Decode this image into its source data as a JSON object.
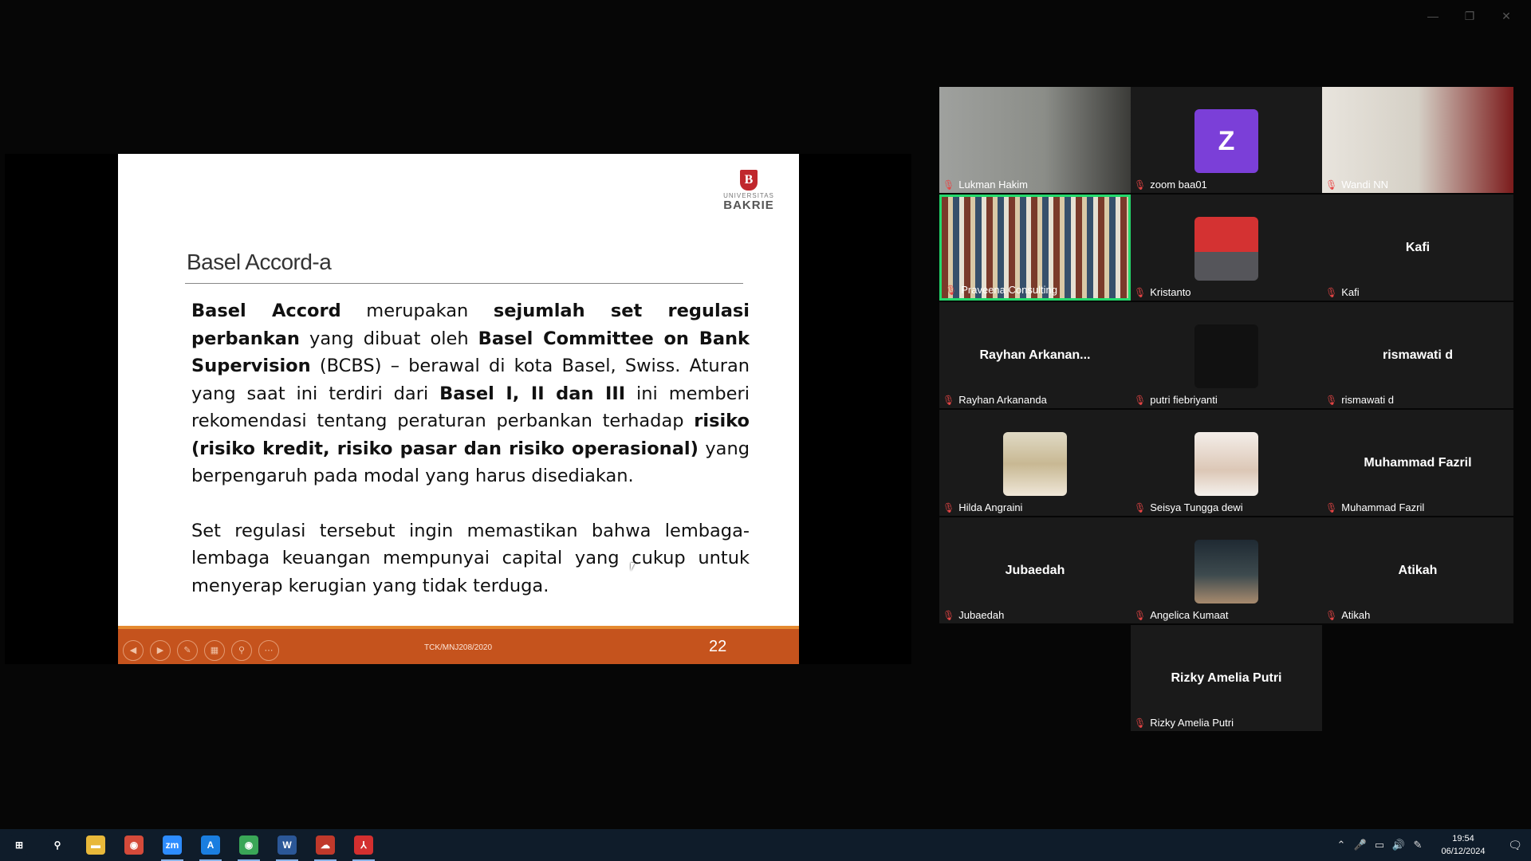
{
  "window": {
    "minimize": "—",
    "restore": "❐",
    "close": "✕"
  },
  "slide": {
    "logo_sub": "UNIVERSITAS",
    "logo_main": "BAKRIE",
    "title": "Basel Accord-a",
    "p1_segments": [
      {
        "t": "Basel Accord",
        "b": true
      },
      {
        "t": " merupakan ",
        "b": false
      },
      {
        "t": "sejumlah set regulasi perbankan",
        "b": true
      },
      {
        "t": " yang dibuat oleh ",
        "b": false
      },
      {
        "t": "Basel Committee on Bank Supervision",
        "b": true
      },
      {
        "t": " (BCBS) – berawal  di kota Basel, Swiss. Aturan yang saat ini terdiri dari ",
        "b": false
      },
      {
        "t": "Basel I, II dan III",
        "b": true
      },
      {
        "t": " ini memberi rekomendasi tentang peraturan perbankan terhadap ",
        "b": false
      },
      {
        "t": "risiko (risiko kredit, risiko pasar dan risiko operasional)",
        "b": true
      },
      {
        "t": " yang berpengaruh pada modal yang harus disediakan.",
        "b": false
      }
    ],
    "p2": "Set regulasi tersebut ingin memastikan bahwa lembaga-lembaga keuangan mempunyai capital yang cukup untuk menyerap kerugian yang tidak terduga.",
    "footer_code": "TCK/MNJ208/2020",
    "page_number": "22",
    "controls": [
      "◀",
      "▶",
      "✎",
      "▦",
      "⚲",
      "⋯"
    ]
  },
  "participants": [
    {
      "name": "Lukman Hakim",
      "kind": "video-man"
    },
    {
      "name": "zoom baa01",
      "kind": "letter",
      "letter": "Z"
    },
    {
      "name": "Wandi NN",
      "kind": "video-office"
    },
    {
      "name": "Praveena Consulting",
      "kind": "video-books",
      "active": true
    },
    {
      "name": "Kristanto",
      "kind": "avatar-red"
    },
    {
      "name": "Kafi",
      "kind": "text",
      "display": "Kafi"
    },
    {
      "name": "Rayhan Arkananda",
      "kind": "text",
      "display": "Rayhan  Arkanan..."
    },
    {
      "name": "putri fiebriyanti",
      "kind": "avatar-dark"
    },
    {
      "name": "rismawati d",
      "kind": "text",
      "display": "rismawati d"
    },
    {
      "name": "Hilda Angraini",
      "kind": "avatar-hijab"
    },
    {
      "name": "Seisya Tungga dewi",
      "kind": "avatar-woman"
    },
    {
      "name": "Muhammad Fazril",
      "kind": "text",
      "display": "Muhammad Fazril"
    },
    {
      "name": "Jubaedah",
      "kind": "text",
      "display": "Jubaedah"
    },
    {
      "name": "Angelica Kumaat",
      "kind": "avatar-night"
    },
    {
      "name": "Atikah",
      "kind": "text",
      "display": "Atikah"
    },
    {
      "name": "Rizky Amelia Putri",
      "kind": "text",
      "display": "Rizky Amelia Putri"
    }
  ],
  "taskbar": {
    "apps": [
      {
        "name": "windows-start-icon",
        "glyph": "⊞",
        "color": "#0f1c2a",
        "running": false
      },
      {
        "name": "search-icon",
        "glyph": "⚲",
        "color": "#0f1c2a",
        "running": false
      },
      {
        "name": "file-explorer-icon",
        "glyph": "▬",
        "color": "#e8b83a",
        "running": false
      },
      {
        "name": "chrome-icon",
        "glyph": "◉",
        "color": "#d44a3a",
        "running": false
      },
      {
        "name": "zoom-icon",
        "glyph": "zm",
        "color": "#2d8cff",
        "running": true
      },
      {
        "name": "app-a-icon",
        "glyph": "A",
        "color": "#1a7ee0",
        "running": true
      },
      {
        "name": "chrome-profile-icon",
        "glyph": "◉",
        "color": "#3aa657",
        "running": true
      },
      {
        "name": "word-icon",
        "glyph": "W",
        "color": "#2b5797",
        "running": true
      },
      {
        "name": "app-cloud-icon",
        "glyph": "☁",
        "color": "#c0392b",
        "running": true
      },
      {
        "name": "acrobat-icon",
        "glyph": "⅄",
        "color": "#d32f2f",
        "running": true
      }
    ],
    "tray_icons": [
      {
        "name": "chevron-up-icon",
        "glyph": "⌃"
      },
      {
        "name": "microphone-icon",
        "glyph": "🎤"
      },
      {
        "name": "network-icon",
        "glyph": "▭"
      },
      {
        "name": "volume-icon",
        "glyph": "🔊"
      },
      {
        "name": "pen-icon",
        "glyph": "✎"
      }
    ],
    "time": "19:54",
    "date": "06/12/2024",
    "notification": "🗨"
  }
}
